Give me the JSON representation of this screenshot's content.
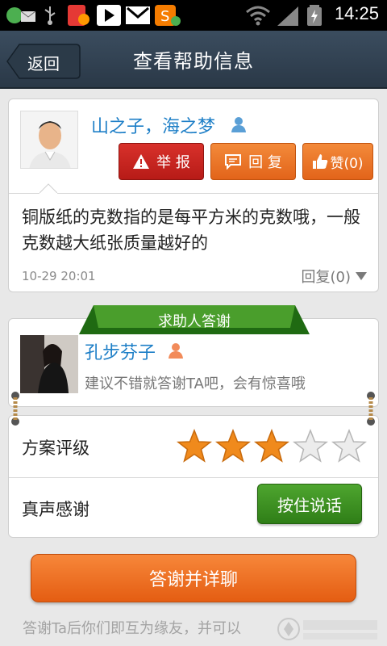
{
  "status_bar": {
    "time": "14:25"
  },
  "header": {
    "back_label": "返回",
    "title": "查看帮助信息"
  },
  "post": {
    "author": "山之子，海之梦",
    "report_label": "举 报",
    "reply_label": "回 复",
    "like_label": "赞(0)",
    "content": "铜版纸的克数指的是每平方米的克数哦，一般克数越大纸张质量越好的",
    "timestamp": "10-29 20:01",
    "reply_count_label": "回复(0)"
  },
  "thanks": {
    "banner_label": "求助人答谢",
    "helper_name": "孔步芬子",
    "hint": "建议不错就答谢TA吧，会有惊喜哦"
  },
  "rating": {
    "label": "方案评级",
    "stars_filled": 3,
    "stars_total": 5,
    "colors": {
      "filled": "#f08a1c",
      "empty": "#e0e0e0"
    }
  },
  "voice": {
    "label": "真声感谢",
    "button_label": "按住说话"
  },
  "cta": {
    "label": "答谢并详聊"
  },
  "footer": {
    "text": "答谢Ta后你们即互为缘友，并可以"
  },
  "colors": {
    "accent_orange": "#e8691f",
    "accent_green": "#3a8f22",
    "link_blue": "#1e7fc7",
    "report_red": "#c8231f"
  }
}
